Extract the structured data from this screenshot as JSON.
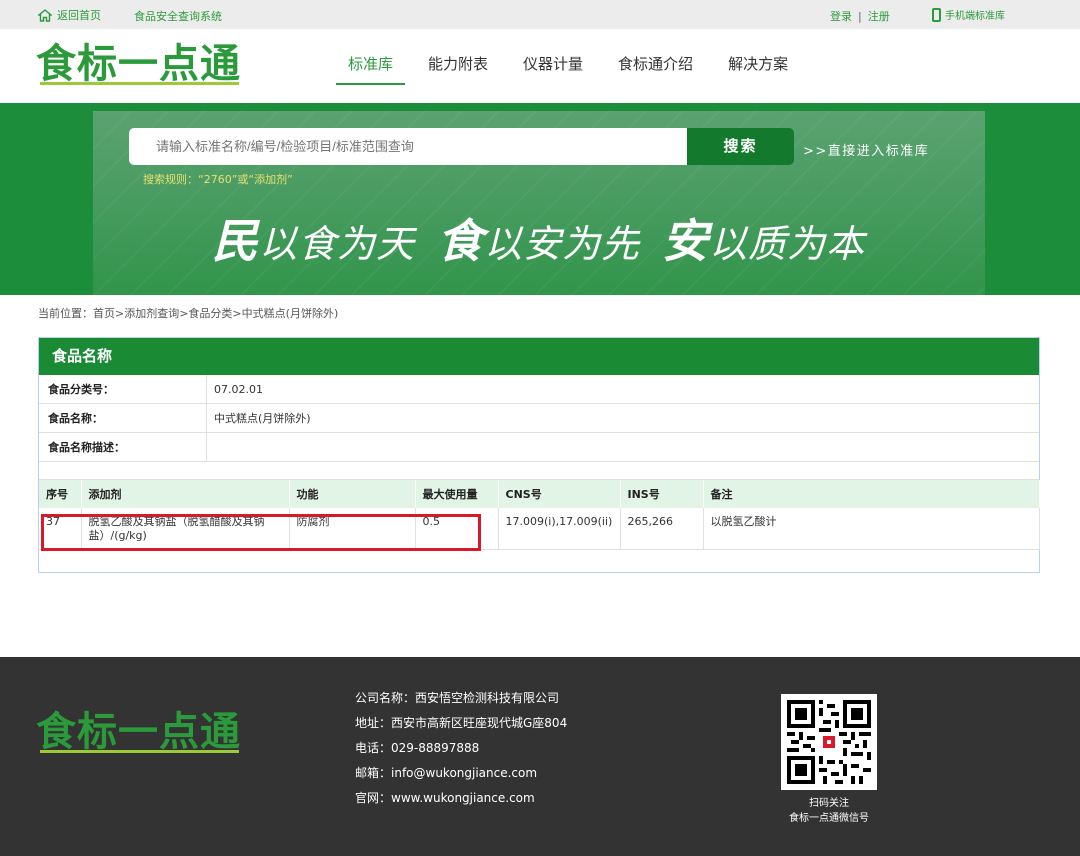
{
  "topbar": {
    "home": "返回首页",
    "system": "食品安全查询系统",
    "login": "登录",
    "sep": "|",
    "register": "注册",
    "mobile": "手机端标准库"
  },
  "header": {
    "logo": "食标一点通",
    "nav": [
      "标准库",
      "能力附表",
      "仪器计量",
      "食标通介绍",
      "解决方案"
    ]
  },
  "banner": {
    "search_placeholder": "请输入标准名称/编号/检验项目/标准范围查询",
    "search_button": "搜索",
    "direct_link": ">>直接进入标准库",
    "search_rule": "搜索规则：“2760”或“添加剂”",
    "slogan": [
      {
        "big": "民",
        "rest": "以食为天"
      },
      {
        "big": "食",
        "rest": "以安为先"
      },
      {
        "big": "安",
        "rest": "以质为本"
      }
    ]
  },
  "breadcrumb": "当前位置：首页>添加剂查询>食品分类>中式糕点(月饼除外)",
  "panel": {
    "title": "食品名称",
    "info": [
      {
        "label": "食品分类号：",
        "value": "07.02.01"
      },
      {
        "label": "食品名称：",
        "value": "中式糕点(月饼除外)"
      },
      {
        "label": "食品名称描述：",
        "value": ""
      }
    ],
    "table": {
      "headers": [
        "序号",
        "添加剂",
        "功能",
        "最大使用量",
        "CNS号",
        "INS号",
        "备注"
      ],
      "rows": [
        [
          "37",
          "脱氢乙酸及其钠盐（脱氢醋酸及其钠盐）/(g/kg)",
          "防腐剂",
          "0.5",
          "17.009(i),17.009(ii)",
          "265,266",
          "以脱氢乙酸计"
        ]
      ]
    }
  },
  "footer": {
    "logo": "食标一点通",
    "company": "公司名称：西安悟空检测科技有限公司",
    "address": "地址：西安市高新区旺座现代城G座804",
    "phone": "电话：029-88897888",
    "email": "邮箱：info@wukongjiance.com",
    "website": "官网：www.wukongjiance.com",
    "qr_line1": "扫码关注",
    "qr_line2": "食标一点通微信号"
  },
  "colors": {
    "brand_green": "#1a8a35",
    "highlight_red": "#d9192a"
  }
}
